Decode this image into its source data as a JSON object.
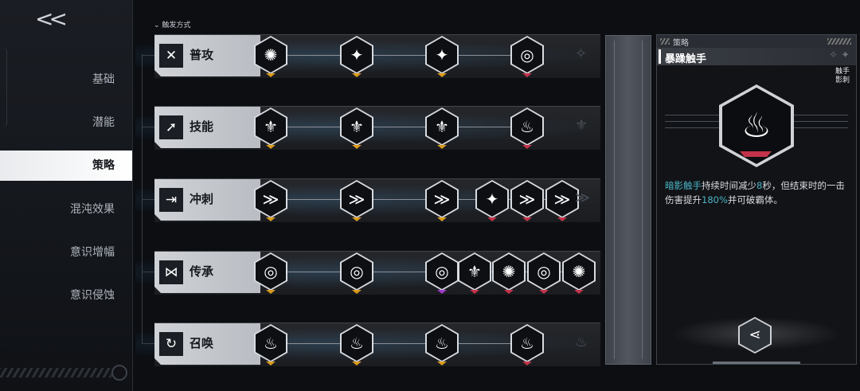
{
  "nav": {
    "back_label": "<<",
    "items": [
      {
        "label": "基础",
        "active": false
      },
      {
        "label": "潜能",
        "active": false
      },
      {
        "label": "策略",
        "active": true
      },
      {
        "label": "混沌效果",
        "active": false
      },
      {
        "label": "意识增幅",
        "active": false
      },
      {
        "label": "意识侵蚀",
        "active": false
      }
    ]
  },
  "header": {
    "trigger_label": "触发方式"
  },
  "rows": [
    {
      "label": "普攻",
      "icon": "crossed-blades-icon",
      "glyph": "✕",
      "nodes": [
        "✺",
        "✦",
        "✦",
        "◎"
      ],
      "extra": [],
      "ghost": "✧"
    },
    {
      "label": "技能",
      "icon": "burst-arrow-icon",
      "glyph": "➚",
      "nodes": [
        "⚜",
        "⚜",
        "⚜",
        "♨"
      ],
      "extra": [],
      "ghost": "⚜"
    },
    {
      "label": "冲刺",
      "icon": "dash-runner-icon",
      "glyph": "⇥",
      "nodes": [
        "≫",
        "≫",
        "≫"
      ],
      "extra": [
        "✦",
        "≫",
        "≫"
      ],
      "ghost": "≫"
    },
    {
      "label": "传承",
      "icon": "dna-helix-icon",
      "glyph": "⋈",
      "nodes": [
        "◎",
        "◎"
      ],
      "extra": [
        "◎",
        "⚜",
        "✺",
        "◎",
        "✺"
      ],
      "ghost": ""
    },
    {
      "label": "召唤",
      "icon": "summon-cycle-icon",
      "glyph": "↻",
      "nodes": [
        "♨",
        "♨",
        "♨",
        "♨"
      ],
      "extra": [],
      "ghost": "♨"
    }
  ],
  "detail": {
    "section": "策略",
    "title": "暴躁触手",
    "tag": "触手影刺",
    "desc_parts": [
      {
        "text": "暗影触手",
        "hl": true
      },
      {
        "text": "持续时间减少",
        "hl": false
      },
      {
        "text": "8",
        "hl": true
      },
      {
        "text": "秒，但结束时的一击伤害提升",
        "hl": false
      },
      {
        "text": "180%",
        "hl": true
      },
      {
        "text": "并可破霸体。",
        "hl": false
      }
    ],
    "big_icon": "flame-tentacle-icon",
    "big_glyph": "♨",
    "share_glyph": "⋖"
  },
  "colors": {
    "accent": "#4ab4c4",
    "mark_gold": "#d99a1c",
    "mark_red": "#c2334a",
    "mark_purple": "#a23bc9"
  }
}
